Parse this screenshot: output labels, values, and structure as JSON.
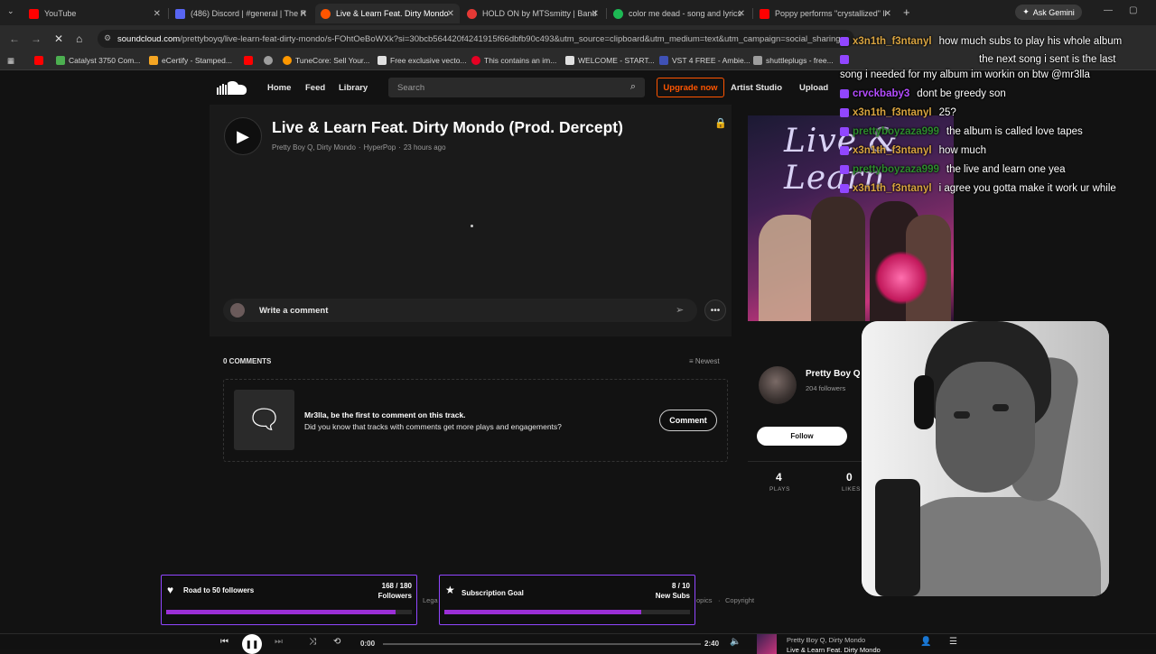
{
  "browser": {
    "tabs": [
      {
        "title": "YouTube",
        "color": "#ff0000"
      },
      {
        "title": "(486) Discord | #general | The R",
        "color": "#5865f2"
      },
      {
        "title": "Live & Learn Feat. Dirty Mondo",
        "color": "#ff5500"
      },
      {
        "title": "HOLD ON by MTSsmitty | Band",
        "color": "#e53935"
      },
      {
        "title": "color me dead - song and lyrics",
        "color": "#1db954"
      },
      {
        "title": "Poppy performs \"crystallized\" li",
        "color": "#ff0000"
      }
    ],
    "new_tab": "+",
    "gemini_label": "Ask Gemini",
    "url_host": "soundcloud.com",
    "url_path": "/prettyboyq/live-learn-feat-dirty-mondo/s-FOhtOeBoWXk?si=30bcb564420f4241915f66dbfb90c493&utm_source=clipboard&utm_medium=text&utm_campaign=social_sharing",
    "bookmarks": [
      {
        "label": "Catalyst 3750 Com...",
        "color": "#4caf50"
      },
      {
        "label": "eCertify - Stamped...",
        "color": "#f5a623"
      },
      {
        "label": "TuneCore: Sell Your...",
        "color": "#ff9800"
      },
      {
        "label": "Free exclusive vecto...",
        "color": "#e0e0e0"
      },
      {
        "label": "This contains an im...",
        "color": "#e60023"
      },
      {
        "label": "WELCOME - START...",
        "color": "#e0e0e0"
      },
      {
        "label": "VST 4 FREE - Ambie...",
        "color": "#3f51b5"
      },
      {
        "label": "shuttleplugs - free...",
        "color": "#9e9e9e"
      }
    ]
  },
  "soundcloud": {
    "nav": {
      "home": "Home",
      "feed": "Feed",
      "library": "Library",
      "search_placeholder": "Search",
      "upgrade": "Upgrade now",
      "artist_studio": "Artist Studio",
      "upload": "Upload"
    },
    "track": {
      "title": "Live & Learn Feat. Dirty Mondo (Prod. Dercept)",
      "artists": "Pretty Boy Q, Dirty Mondo",
      "genre": "HyperPop",
      "posted": "23 hours ago",
      "artwork_text": "Live & Learn"
    },
    "comment_placeholder": "Write a comment",
    "comments_count_label": "0 COMMENTS",
    "sort_label": "Newest",
    "empty_title": "Mr3lla, be the first to comment on this track.",
    "empty_sub": "Did you know that tracks with comments get more plays and engagements?",
    "comment_button": "Comment",
    "artist": {
      "name": "Pretty Boy Q",
      "followers": "204 followers",
      "follow_button": "Follow"
    },
    "stats": [
      {
        "value": "4",
        "label": "PLAYS"
      },
      {
        "value": "0",
        "label": "LIKES"
      }
    ],
    "footer_links": [
      "Lega",
      "opics",
      "Copyright"
    ]
  },
  "player": {
    "elapsed": "0:00",
    "duration": "2:40",
    "now_artist": "Pretty Boy Q, Dirty Mondo",
    "now_title": "Live & Learn Feat. Dirty Mondo",
    "progress": 0.0
  },
  "stream_overlay": {
    "chat": [
      {
        "user": "x3n1th_f3ntanyl",
        "text": "how much subs to play his whole album",
        "color": "#d9a441"
      },
      {
        "user": "",
        "text": "song i needed for my album im workin on btw @mr3lla",
        "color": "#ffffff"
      },
      {
        "user": "crvckbaby3",
        "text": "dont be greedy son",
        "color": "#b44cff"
      },
      {
        "user": "x3n1th_f3ntanyl",
        "text": "25?",
        "color": "#d9a441"
      },
      {
        "user": "prettyboyzaza999",
        "text": "the album is called love tapes",
        "color": "#2e8b2e"
      },
      {
        "user": "x3n1th_f3ntanyl",
        "text": "how much",
        "color": "#d9a441"
      },
      {
        "user": "prettyboyzaza999",
        "text": "the live and learn one yea",
        "color": "#2e8b2e"
      },
      {
        "user": "x3n1th_f3ntanyl",
        "text": "i agree you gotta make it work ur while",
        "color": "#d9a441"
      }
    ],
    "chat_extra": "the next song i sent is the last",
    "goals": [
      {
        "title": "Road to 50 followers",
        "current": 168,
        "target": 180,
        "count_label": "168 / 180",
        "unit": "Followers",
        "fraction": 0.933
      },
      {
        "title": "Subscription Goal",
        "current": 8,
        "target": 10,
        "count_label": "8 / 10",
        "unit": "New Subs",
        "fraction": 0.8
      }
    ]
  },
  "colors": {
    "accent": "#ff5500",
    "goal_border": "#9146ff",
    "goal_fill": "#9b2fd6"
  }
}
